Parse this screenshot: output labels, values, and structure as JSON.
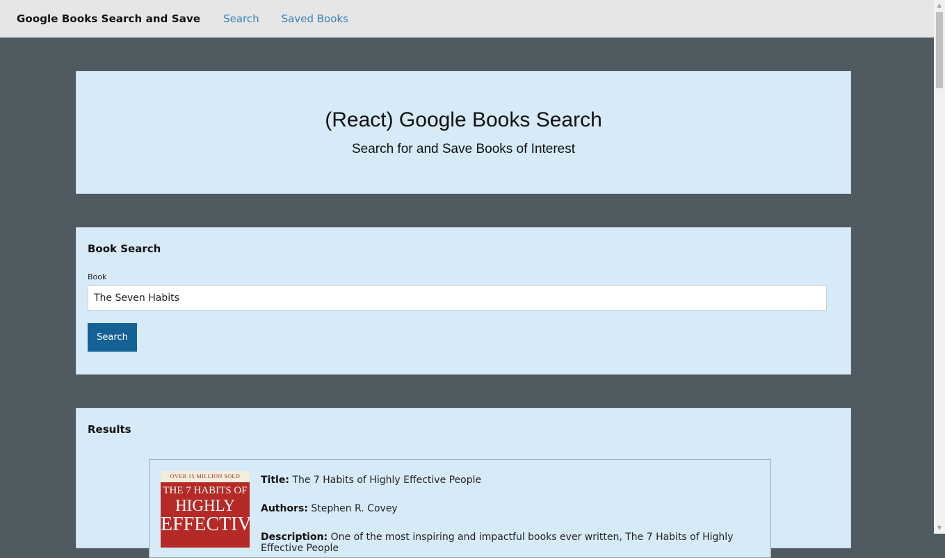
{
  "navbar": {
    "brand": "Google Books Search and Save",
    "links": [
      "Search",
      "Saved Books"
    ]
  },
  "jumbotron": {
    "title": "(React) Google Books Search",
    "subtitle": "Search for and Save Books of Interest"
  },
  "search": {
    "heading": "Book Search",
    "field_label": "Book",
    "value": "The Seven Habits",
    "button_label": "Search"
  },
  "results": {
    "heading": "Results",
    "items": [
      {
        "cover_banner": "OVER 15 MILLION SOLD",
        "cover_line1": "THE 7 HABITS OF",
        "cover_line2": "HIGHLY",
        "cover_line3": "EFFECTIVE",
        "title_label": "Title:",
        "title": "The 7 Habits of Highly Effective People",
        "authors_label": "Authors:",
        "authors": "Stephen R. Covey",
        "description_label": "Description:",
        "description": "One of the most inspiring and impactful books ever written, The 7 Habits of Highly Effective People"
      }
    ]
  },
  "colors": {
    "background": "#505a61",
    "panel": "#d6eaf8",
    "navbar": "#e6e6e6",
    "link": "#3a7fb8",
    "button": "#136195"
  }
}
